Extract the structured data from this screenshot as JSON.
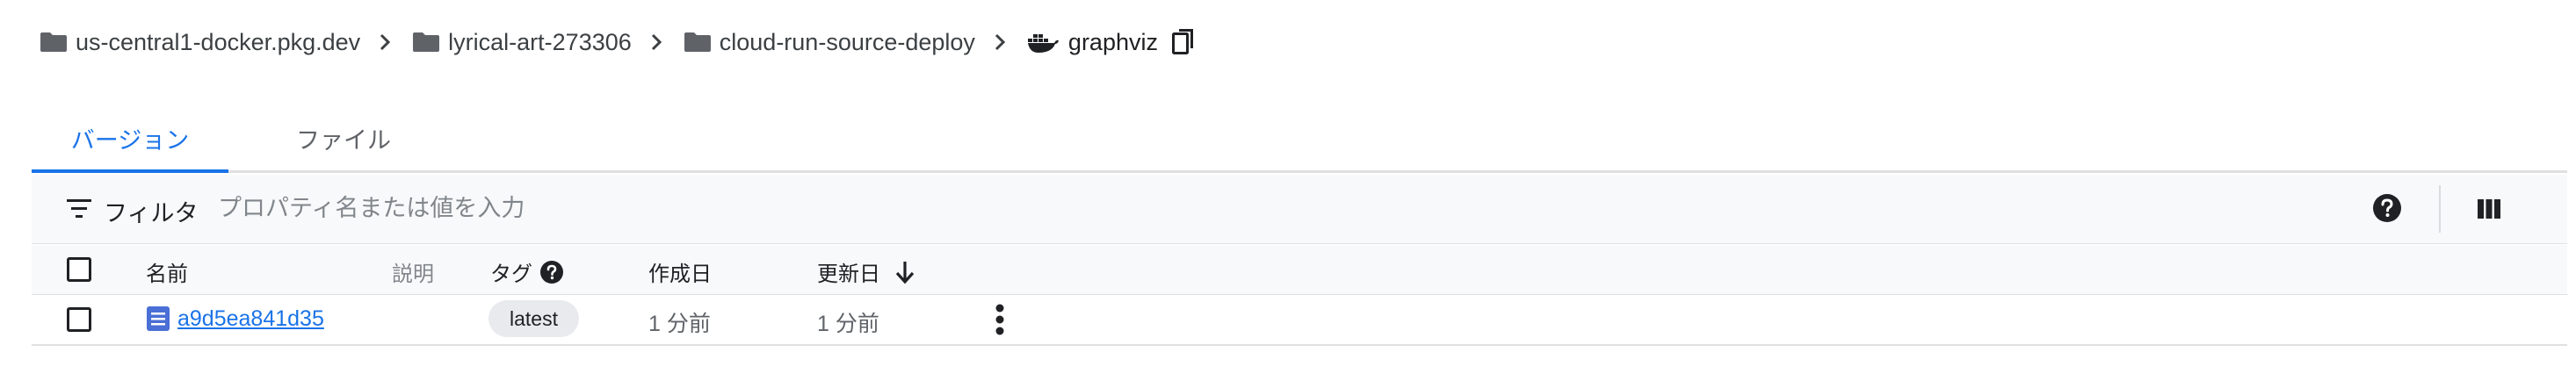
{
  "breadcrumb": {
    "items": [
      {
        "label": "us-central1-docker.pkg.dev",
        "icon": "folder-icon"
      },
      {
        "label": "lyrical-art-273306",
        "icon": "folder-icon"
      },
      {
        "label": "cloud-run-source-deploy",
        "icon": "folder-icon"
      },
      {
        "label": "graphviz",
        "icon": "docker-icon"
      }
    ],
    "copy_icon": "copy-icon"
  },
  "tabs": [
    {
      "label": "バージョン",
      "active": true
    },
    {
      "label": "ファイル",
      "active": false
    }
  ],
  "filter": {
    "label": "フィルタ",
    "placeholder": "プロパティ名または値を入力",
    "value": ""
  },
  "table": {
    "columns": {
      "name": "名前",
      "description": "説明",
      "tags": "タグ",
      "created": "作成日",
      "updated": "更新日"
    },
    "rows": [
      {
        "name": "a9d5ea841d35",
        "description": "",
        "tag": "latest",
        "created": "1 分前",
        "updated": "1 分前"
      }
    ]
  },
  "colors": {
    "accent": "#1a73e8",
    "text": "#202124",
    "muted": "#80868b",
    "header_bg": "#f8f9fa",
    "chip_bg": "#e8eaed"
  }
}
